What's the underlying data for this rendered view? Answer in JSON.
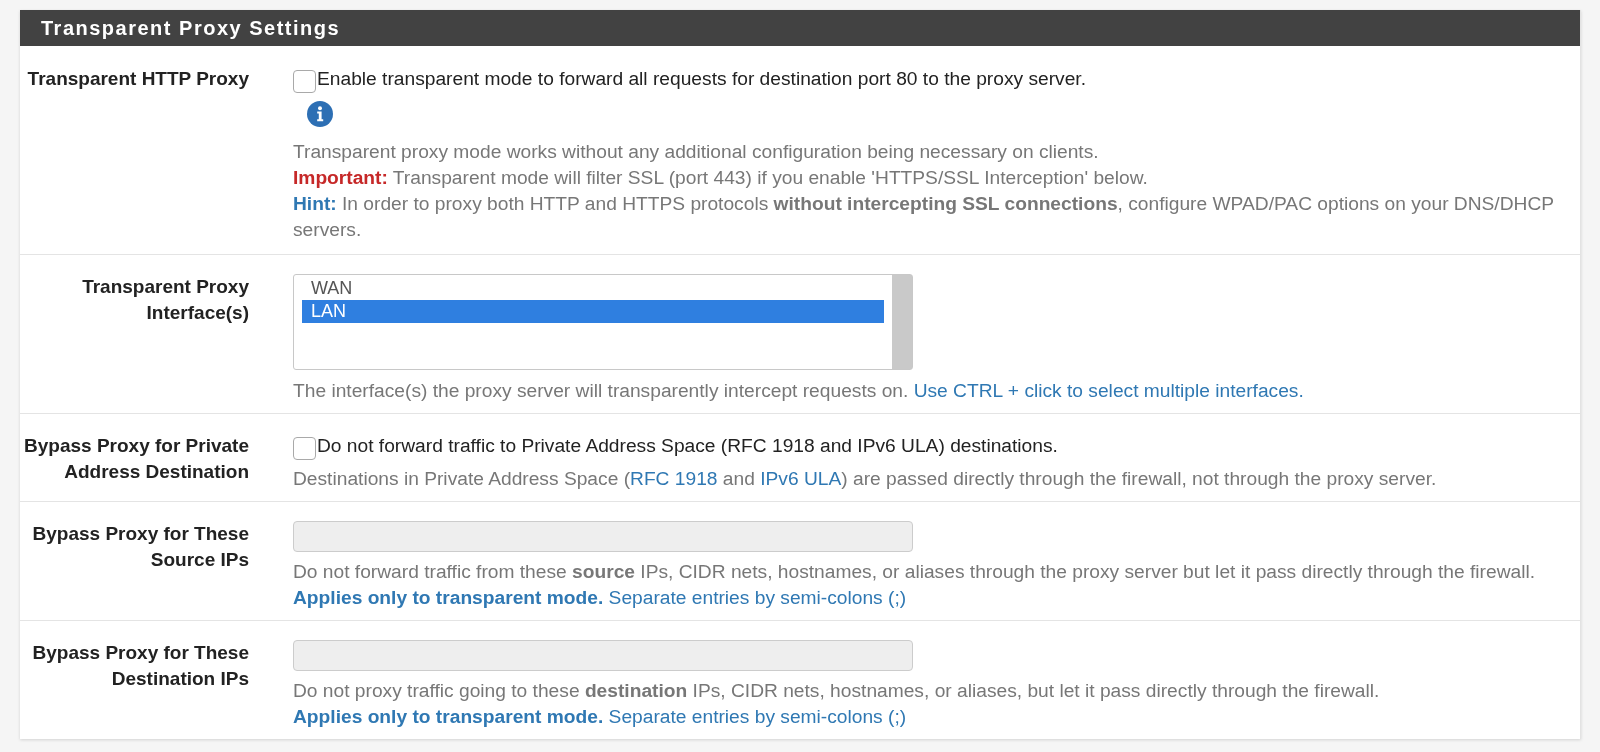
{
  "panel": {
    "title": "Transparent Proxy Settings"
  },
  "rows": [
    {
      "kind": "checkbox",
      "label": "Transparent HTTP Proxy",
      "checkbox_label": "Enable transparent mode to forward all requests for destination port 80 to the proxy server.",
      "checked": false,
      "info_icon": true,
      "help": [
        [
          {
            "kind": "plain",
            "text": "Transparent proxy mode works without any additional configuration being necessary on clients."
          }
        ],
        [
          {
            "kind": "important",
            "text": "Important:"
          },
          {
            "kind": "plain",
            "text": " Transparent mode will filter SSL (port 443) if you enable 'HTTPS/SSL Interception' below."
          }
        ],
        [
          {
            "kind": "hint",
            "text": "Hint:"
          },
          {
            "kind": "plain",
            "text": " In order to proxy both HTTP and HTTPS protocols **without intercepting SSL connections**, configure WPAD/PAC options on your DNS/DHCP servers."
          }
        ]
      ]
    },
    {
      "kind": "listbox",
      "label": "Transparent Proxy Interface(s)",
      "options": [
        {
          "label": "WAN",
          "selected": false
        },
        {
          "label": "LAN",
          "selected": true
        }
      ],
      "help": [
        [
          {
            "kind": "plain",
            "text": "The interface(s) the proxy server will transparently intercept requests on. "
          },
          {
            "kind": "info",
            "text": "Use CTRL + click to select multiple interfaces."
          }
        ]
      ]
    },
    {
      "kind": "checkbox",
      "label": "Bypass Proxy for Private Address Destination",
      "checkbox_label": "Do not forward traffic to Private Address Space (RFC 1918 and IPv6 ULA) destinations.",
      "checked": false,
      "help": [
        [
          {
            "kind": "plain",
            "text": "Destinations in Private Address Space ("
          },
          {
            "kind": "link",
            "text": "RFC 1918"
          },
          {
            "kind": "plain",
            "text": " and "
          },
          {
            "kind": "link",
            "text": "IPv6 ULA"
          },
          {
            "kind": "plain",
            "text": ") are passed directly through the firewall, not through the proxy server."
          }
        ]
      ]
    },
    {
      "kind": "text_input",
      "label": "Bypass Proxy for These Source IPs",
      "disabled": true,
      "help": [
        [
          {
            "kind": "plain",
            "text": "Do not forward traffic from these **source** IPs, CIDR nets, hostnames, or aliases through the proxy server but let it pass directly through the firewall."
          }
        ],
        [
          {
            "kind": "info",
            "text": "**Applies only to transparent mode.** Separate entries by semi-colons (;)"
          }
        ]
      ]
    },
    {
      "kind": "text_input",
      "label": "Bypass Proxy for These Destination IPs",
      "disabled": true,
      "help": [
        [
          {
            "kind": "plain",
            "text": "Do not proxy traffic going to these **destination** IPs, CIDR nets, hostnames, or aliases, but let it pass directly through the firewall."
          }
        ],
        [
          {
            "kind": "info",
            "text": "**Applies only to transparent mode.** Separate entries by semi-colons (;)"
          }
        ]
      ]
    }
  ]
}
